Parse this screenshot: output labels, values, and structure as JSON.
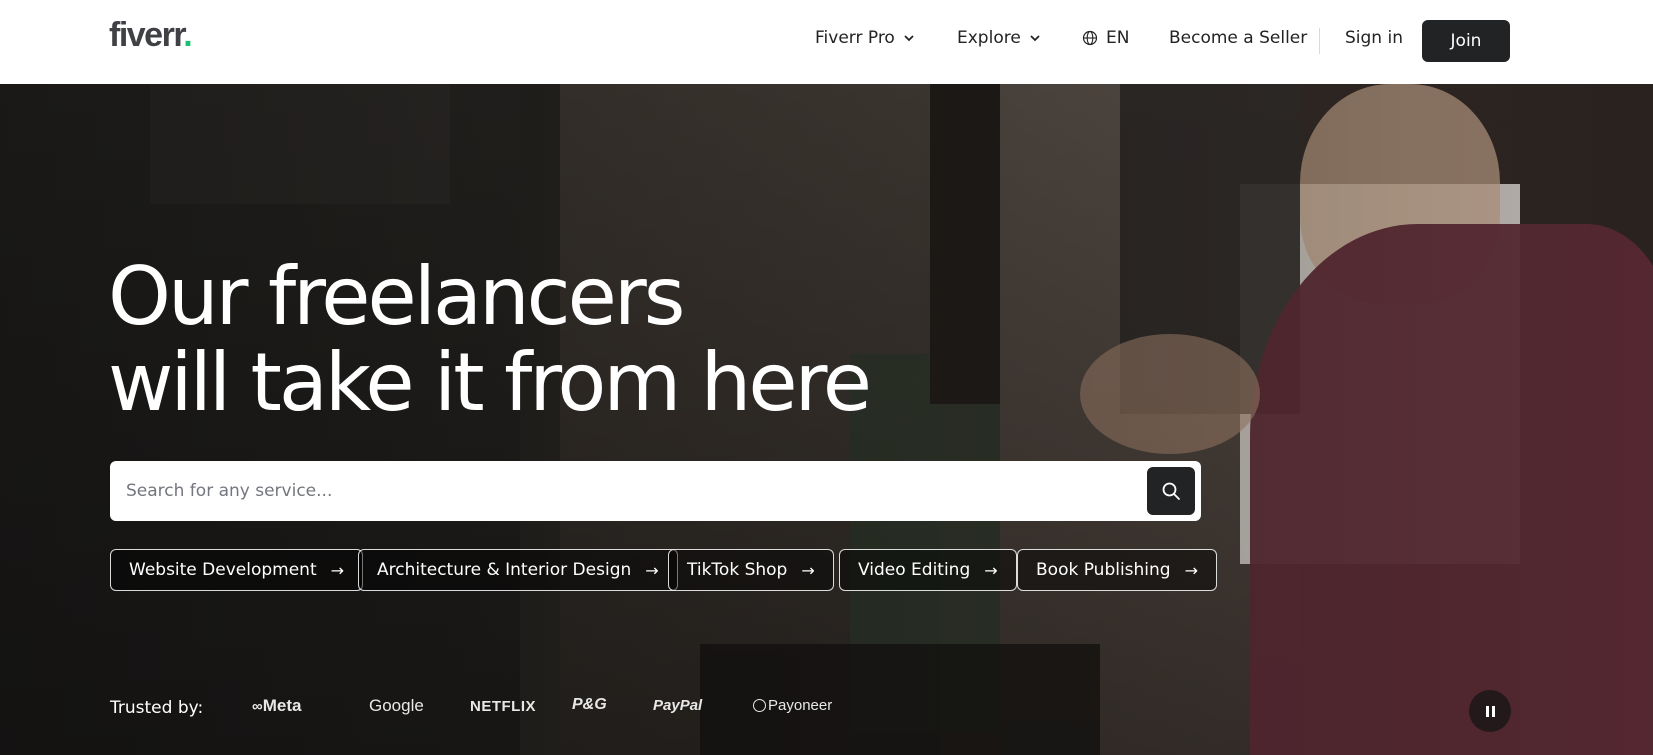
{
  "header": {
    "logo_text": "fiverr",
    "logo_dot": ".",
    "nav": {
      "fiverr_pro": "Fiverr Pro",
      "explore": "Explore",
      "language": "EN",
      "become_seller": "Become a Seller",
      "sign_in": "Sign in",
      "join": "Join"
    }
  },
  "hero": {
    "headline_line1": "Our freelancers",
    "headline_line2": "will take it from here",
    "search": {
      "placeholder": "Search for any service..."
    },
    "chips": [
      {
        "label": "Website Development"
      },
      {
        "label": "Architecture & Interior Design"
      },
      {
        "label": "TikTok Shop"
      },
      {
        "label": "Video Editing"
      },
      {
        "label": "Book Publishing"
      }
    ],
    "arrow": "→",
    "trusted_label": "Trusted by:",
    "brands": [
      "Meta",
      "Google",
      "NETFLIX",
      "P&G",
      "PayPal",
      "Payoneer"
    ]
  },
  "colors": {
    "accent": "#1dbf73",
    "dark": "#222325"
  },
  "icons": [
    "chevron-down-icon",
    "globe-icon",
    "search-icon",
    "arrow-right-icon",
    "pause-icon"
  ]
}
